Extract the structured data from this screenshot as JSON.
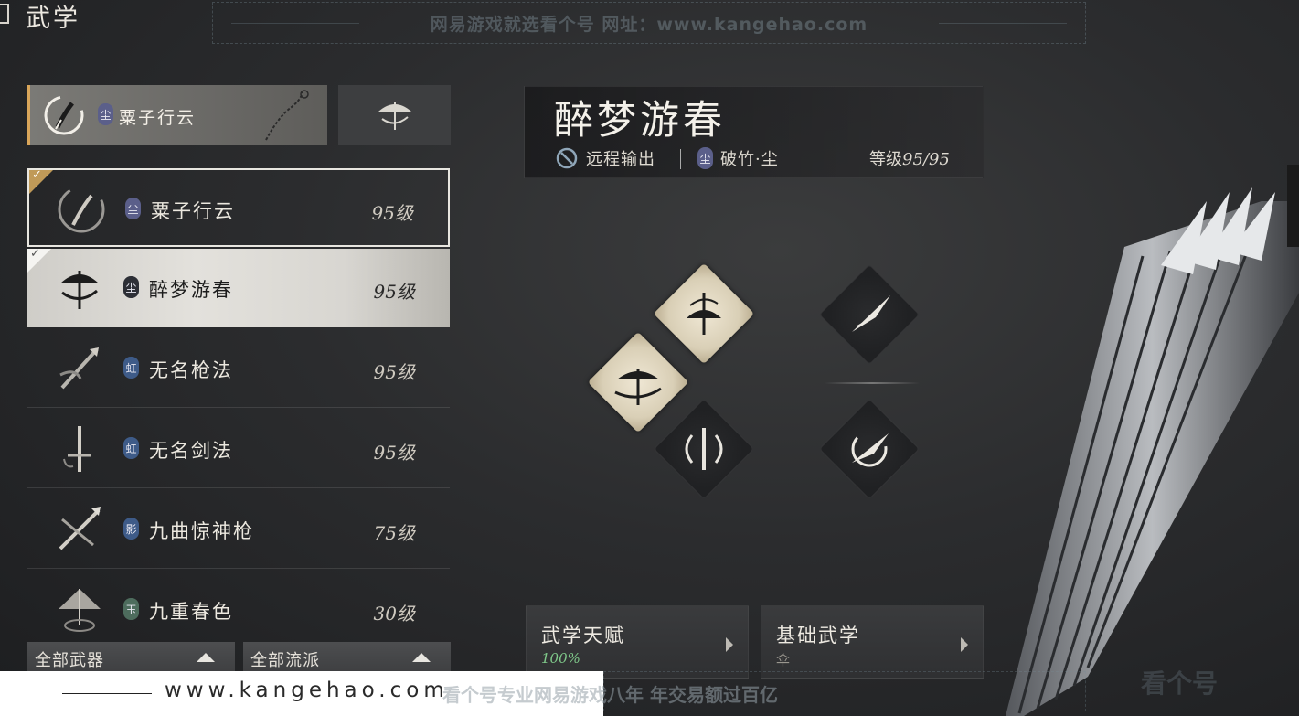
{
  "header": {
    "title": "武学"
  },
  "watermark": {
    "top_text": "网易游戏就选看个号   网址：www.kangehao.com",
    "bottom_url": "www.kangehao.com",
    "bottom_text": "看个号专业网易游戏八年   年交易额过百亿",
    "logo_text": "看个号"
  },
  "equipped": {
    "primary": {
      "name": "粟子行云",
      "tag": "尘",
      "icon": "bow-swirl-icon"
    },
    "secondary": {
      "icon": "umbrella-icon"
    }
  },
  "weapons": [
    {
      "name": "粟子行云",
      "tag": "尘",
      "level": "95级",
      "icon": "bow-swirl-icon",
      "checked": true
    },
    {
      "name": "醉梦游春",
      "tag": "尘",
      "level": "95级",
      "icon": "umbrella-icon",
      "checked": true
    },
    {
      "name": "无名枪法",
      "tag": "虹",
      "level": "95级",
      "icon": "spear-icon",
      "checked": false
    },
    {
      "name": "无名剑法",
      "tag": "虹",
      "level": "95级",
      "icon": "sword-icon",
      "checked": false
    },
    {
      "name": "九曲惊神枪",
      "tag": "影",
      "level": "75级",
      "icon": "crossed-spear-icon",
      "checked": false
    },
    {
      "name": "九重春色",
      "tag": "玉",
      "level": "30级",
      "icon": "parasol-icon",
      "checked": false
    }
  ],
  "filters": {
    "weapon": "全部武器",
    "school": "全部流派"
  },
  "skill": {
    "title": "醉梦游春",
    "type_label": "远程输出",
    "school_tag": "尘",
    "school_label": "破竹·尘",
    "level_prefix": "等级",
    "level_value": "95/95"
  },
  "buttons": {
    "talent": {
      "label": "武学天赋",
      "sub": "100%"
    },
    "basic": {
      "label": "基础武学",
      "sub": "伞"
    }
  },
  "colors": {
    "accent_gold": "#d9a65a",
    "talent_green": "#7fc98a",
    "tag_purple": "#5b5f8a"
  }
}
